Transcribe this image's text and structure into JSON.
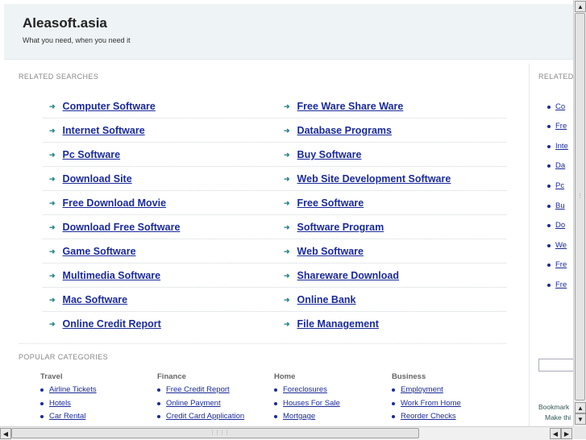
{
  "header": {
    "site_title": "Aleasoft.asia",
    "tagline": "What you need, when you need it"
  },
  "related": {
    "label": "RELATED SEARCHES",
    "left": [
      "Computer Software",
      "Internet Software",
      "Pc Software",
      "Download Site",
      "Free Download Movie",
      "Download Free Software",
      "Game Software",
      "Multimedia Software",
      "Mac Software",
      "Online Credit Report"
    ],
    "right": [
      "Free Ware Share Ware",
      "Database Programs",
      "Buy Software",
      "Web Site Development Software",
      "Free Software",
      "Software Program",
      "Web Software",
      "Shareware Download",
      "Online Bank",
      "File Management"
    ]
  },
  "popular": {
    "label": "POPULAR CATEGORIES",
    "categories": [
      {
        "title": "Travel",
        "items": [
          "Airline Tickets",
          "Hotels",
          "Car Rental"
        ]
      },
      {
        "title": "Finance",
        "items": [
          "Free Credit Report",
          "Online Payment",
          "Credit Card Application"
        ]
      },
      {
        "title": "Home",
        "items": [
          "Foreclosures",
          "Houses For Sale",
          "Mortgage"
        ]
      },
      {
        "title": "Business",
        "items": [
          "Employment",
          "Work From Home",
          "Reorder Checks"
        ]
      }
    ]
  },
  "sidebar": {
    "label": "RELATED",
    "items": [
      "Co",
      "Fre",
      "Inte",
      "Da",
      "Pc",
      "Bu",
      "Do",
      "We",
      "Fre",
      "Fre"
    ],
    "bookmark_text": "Bookmark",
    "make_text": "Make thi"
  }
}
